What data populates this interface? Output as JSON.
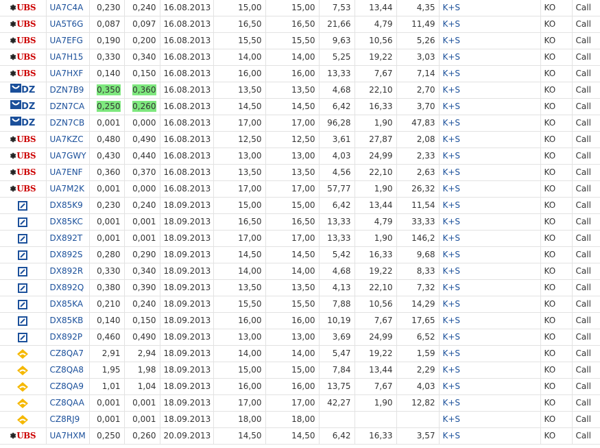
{
  "colors": {
    "link": "#1a4f9a",
    "highlight": "#7ee87e",
    "ubs_red": "#cc0000",
    "grid": "#e2e2e2"
  },
  "rows": [
    {
      "issuer": "ubs",
      "code": "UA7C4A",
      "bid": "0,230",
      "ask": "0,240",
      "date": "16.08.2013",
      "strike": "15,00",
      "strike2": "15,00",
      "lev": "7,53",
      "ratio": "13,44",
      "prem": "4,35",
      "under": "K+S",
      "type": "KO",
      "opt": "Call",
      "hl": false
    },
    {
      "issuer": "ubs",
      "code": "UA5T6G",
      "bid": "0,087",
      "ask": "0,097",
      "date": "16.08.2013",
      "strike": "16,50",
      "strike2": "16,50",
      "lev": "21,66",
      "ratio": "4,79",
      "prem": "11,49",
      "under": "K+S",
      "type": "KO",
      "opt": "Call",
      "hl": false
    },
    {
      "issuer": "ubs",
      "code": "UA7EFG",
      "bid": "0,190",
      "ask": "0,200",
      "date": "16.08.2013",
      "strike": "15,50",
      "strike2": "15,50",
      "lev": "9,63",
      "ratio": "10,56",
      "prem": "5,26",
      "under": "K+S",
      "type": "KO",
      "opt": "Call",
      "hl": false
    },
    {
      "issuer": "ubs",
      "code": "UA7H15",
      "bid": "0,330",
      "ask": "0,340",
      "date": "16.08.2013",
      "strike": "14,00",
      "strike2": "14,00",
      "lev": "5,25",
      "ratio": "19,22",
      "prem": "3,03",
      "under": "K+S",
      "type": "KO",
      "opt": "Call",
      "hl": false
    },
    {
      "issuer": "ubs",
      "code": "UA7HXF",
      "bid": "0,140",
      "ask": "0,150",
      "date": "16.08.2013",
      "strike": "16,00",
      "strike2": "16,00",
      "lev": "13,33",
      "ratio": "7,67",
      "prem": "7,14",
      "under": "K+S",
      "type": "KO",
      "opt": "Call",
      "hl": false
    },
    {
      "issuer": "dz",
      "code": "DZN7B9",
      "bid": "0,350",
      "ask": "0,360",
      "date": "16.08.2013",
      "strike": "13,50",
      "strike2": "13,50",
      "lev": "4,68",
      "ratio": "22,10",
      "prem": "2,70",
      "under": "K+S",
      "type": "KO",
      "opt": "Call",
      "hl": true
    },
    {
      "issuer": "dz",
      "code": "DZN7CA",
      "bid": "0,250",
      "ask": "0,260",
      "date": "16.08.2013",
      "strike": "14,50",
      "strike2": "14,50",
      "lev": "6,42",
      "ratio": "16,33",
      "prem": "3,70",
      "under": "K+S",
      "type": "KO",
      "opt": "Call",
      "hl": true
    },
    {
      "issuer": "dz",
      "code": "DZN7CB",
      "bid": "0,001",
      "ask": "0,000",
      "date": "16.08.2013",
      "strike": "17,00",
      "strike2": "17,00",
      "lev": "96,28",
      "ratio": "1,90",
      "prem": "47,83",
      "under": "K+S",
      "type": "KO",
      "opt": "Call",
      "hl": false
    },
    {
      "issuer": "ubs",
      "code": "UA7KZC",
      "bid": "0,480",
      "ask": "0,490",
      "date": "16.08.2013",
      "strike": "12,50",
      "strike2": "12,50",
      "lev": "3,61",
      "ratio": "27,87",
      "prem": "2,08",
      "under": "K+S",
      "type": "KO",
      "opt": "Call",
      "hl": false
    },
    {
      "issuer": "ubs",
      "code": "UA7GWY",
      "bid": "0,430",
      "ask": "0,440",
      "date": "16.08.2013",
      "strike": "13,00",
      "strike2": "13,00",
      "lev": "4,03",
      "ratio": "24,99",
      "prem": "2,33",
      "under": "K+S",
      "type": "KO",
      "opt": "Call",
      "hl": false
    },
    {
      "issuer": "ubs",
      "code": "UA7ENF",
      "bid": "0,360",
      "ask": "0,370",
      "date": "16.08.2013",
      "strike": "13,50",
      "strike2": "13,50",
      "lev": "4,56",
      "ratio": "22,10",
      "prem": "2,63",
      "under": "K+S",
      "type": "KO",
      "opt": "Call",
      "hl": false
    },
    {
      "issuer": "ubs",
      "code": "UA7M2K",
      "bid": "0,001",
      "ask": "0,000",
      "date": "16.08.2013",
      "strike": "17,00",
      "strike2": "17,00",
      "lev": "57,77",
      "ratio": "1,90",
      "prem": "26,32",
      "under": "K+S",
      "type": "KO",
      "opt": "Call",
      "hl": false
    },
    {
      "issuer": "db",
      "code": "DX85K9",
      "bid": "0,230",
      "ask": "0,240",
      "date": "18.09.2013",
      "strike": "15,00",
      "strike2": "15,00",
      "lev": "6,42",
      "ratio": "13,44",
      "prem": "11,54",
      "under": "K+S",
      "type": "KO",
      "opt": "Call",
      "hl": false
    },
    {
      "issuer": "db",
      "code": "DX85KC",
      "bid": "0,001",
      "ask": "0,001",
      "date": "18.09.2013",
      "strike": "16,50",
      "strike2": "16,50",
      "lev": "13,33",
      "ratio": "4,79",
      "prem": "33,33",
      "under": "K+S",
      "type": "KO",
      "opt": "Call",
      "hl": false
    },
    {
      "issuer": "db",
      "code": "DX892T",
      "bid": "0,001",
      "ask": "0,001",
      "date": "18.09.2013",
      "strike": "17,00",
      "strike2": "17,00",
      "lev": "13,33",
      "ratio": "1,90",
      "prem": "146,2",
      "under": "K+S",
      "type": "KO",
      "opt": "Call",
      "hl": false
    },
    {
      "issuer": "db",
      "code": "DX892S",
      "bid": "0,280",
      "ask": "0,290",
      "date": "18.09.2013",
      "strike": "14,50",
      "strike2": "14,50",
      "lev": "5,42",
      "ratio": "16,33",
      "prem": "9,68",
      "under": "K+S",
      "type": "KO",
      "opt": "Call",
      "hl": false
    },
    {
      "issuer": "db",
      "code": "DX892R",
      "bid": "0,330",
      "ask": "0,340",
      "date": "18.09.2013",
      "strike": "14,00",
      "strike2": "14,00",
      "lev": "4,68",
      "ratio": "19,22",
      "prem": "8,33",
      "under": "K+S",
      "type": "KO",
      "opt": "Call",
      "hl": false
    },
    {
      "issuer": "db",
      "code": "DX892Q",
      "bid": "0,380",
      "ask": "0,390",
      "date": "18.09.2013",
      "strike": "13,50",
      "strike2": "13,50",
      "lev": "4,13",
      "ratio": "22,10",
      "prem": "7,32",
      "under": "K+S",
      "type": "KO",
      "opt": "Call",
      "hl": false
    },
    {
      "issuer": "db",
      "code": "DX85KA",
      "bid": "0,210",
      "ask": "0,240",
      "date": "18.09.2013",
      "strike": "15,50",
      "strike2": "15,50",
      "lev": "7,88",
      "ratio": "10,56",
      "prem": "14,29",
      "under": "K+S",
      "type": "KO",
      "opt": "Call",
      "hl": false
    },
    {
      "issuer": "db",
      "code": "DX85KB",
      "bid": "0,140",
      "ask": "0,150",
      "date": "18.09.2013",
      "strike": "16,00",
      "strike2": "16,00",
      "lev": "10,19",
      "ratio": "7,67",
      "prem": "17,65",
      "under": "K+S",
      "type": "KO",
      "opt": "Call",
      "hl": false
    },
    {
      "issuer": "db",
      "code": "DX892P",
      "bid": "0,460",
      "ask": "0,490",
      "date": "18.09.2013",
      "strike": "13,00",
      "strike2": "13,00",
      "lev": "3,69",
      "ratio": "24,99",
      "prem": "6,52",
      "under": "K+S",
      "type": "KO",
      "opt": "Call",
      "hl": false
    },
    {
      "issuer": "cb",
      "code": "CZ8QA7",
      "bid": "2,91",
      "ask": "2,94",
      "date": "18.09.2013",
      "strike": "14,00",
      "strike2": "14,00",
      "lev": "5,47",
      "ratio": "19,22",
      "prem": "1,59",
      "under": "K+S",
      "type": "KO",
      "opt": "Call",
      "hl": false
    },
    {
      "issuer": "cb",
      "code": "CZ8QA8",
      "bid": "1,95",
      "ask": "1,98",
      "date": "18.09.2013",
      "strike": "15,00",
      "strike2": "15,00",
      "lev": "7,84",
      "ratio": "13,44",
      "prem": "2,29",
      "under": "K+S",
      "type": "KO",
      "opt": "Call",
      "hl": false
    },
    {
      "issuer": "cb",
      "code": "CZ8QA9",
      "bid": "1,01",
      "ask": "1,04",
      "date": "18.09.2013",
      "strike": "16,00",
      "strike2": "16,00",
      "lev": "13,75",
      "ratio": "7,67",
      "prem": "4,03",
      "under": "K+S",
      "type": "KO",
      "opt": "Call",
      "hl": false
    },
    {
      "issuer": "cb",
      "code": "CZ8QAA",
      "bid": "0,001",
      "ask": "0,001",
      "date": "18.09.2013",
      "strike": "17,00",
      "strike2": "17,00",
      "lev": "42,27",
      "ratio": "1,90",
      "prem": "12,82",
      "under": "K+S",
      "type": "KO",
      "opt": "Call",
      "hl": false
    },
    {
      "issuer": "cb",
      "code": "CZ8RJ9",
      "bid": "0,001",
      "ask": "0,001",
      "date": "18.09.2013",
      "strike": "18,00",
      "strike2": "18,00",
      "lev": "",
      "ratio": "",
      "prem": "",
      "under": "K+S",
      "type": "KO",
      "opt": "Call",
      "hl": false
    },
    {
      "issuer": "ubs",
      "code": "UA7HXM",
      "bid": "0,250",
      "ask": "0,260",
      "date": "20.09.2013",
      "strike": "14,50",
      "strike2": "14,50",
      "lev": "6,42",
      "ratio": "16,33",
      "prem": "3,57",
      "under": "K+S",
      "type": "KO",
      "opt": "Call",
      "hl": false
    }
  ],
  "logos": {
    "ubs": {
      "text": "UBS",
      "keys": "❃",
      "icon": "ubs-logo-icon"
    },
    "dz": {
      "text": "DZ",
      "mark": "⌠",
      "icon": "dz-bank-logo-icon"
    },
    "db": {
      "icon": "deutsche-bank-logo-icon"
    },
    "cb": {
      "icon": "commerzbank-logo-icon"
    }
  }
}
